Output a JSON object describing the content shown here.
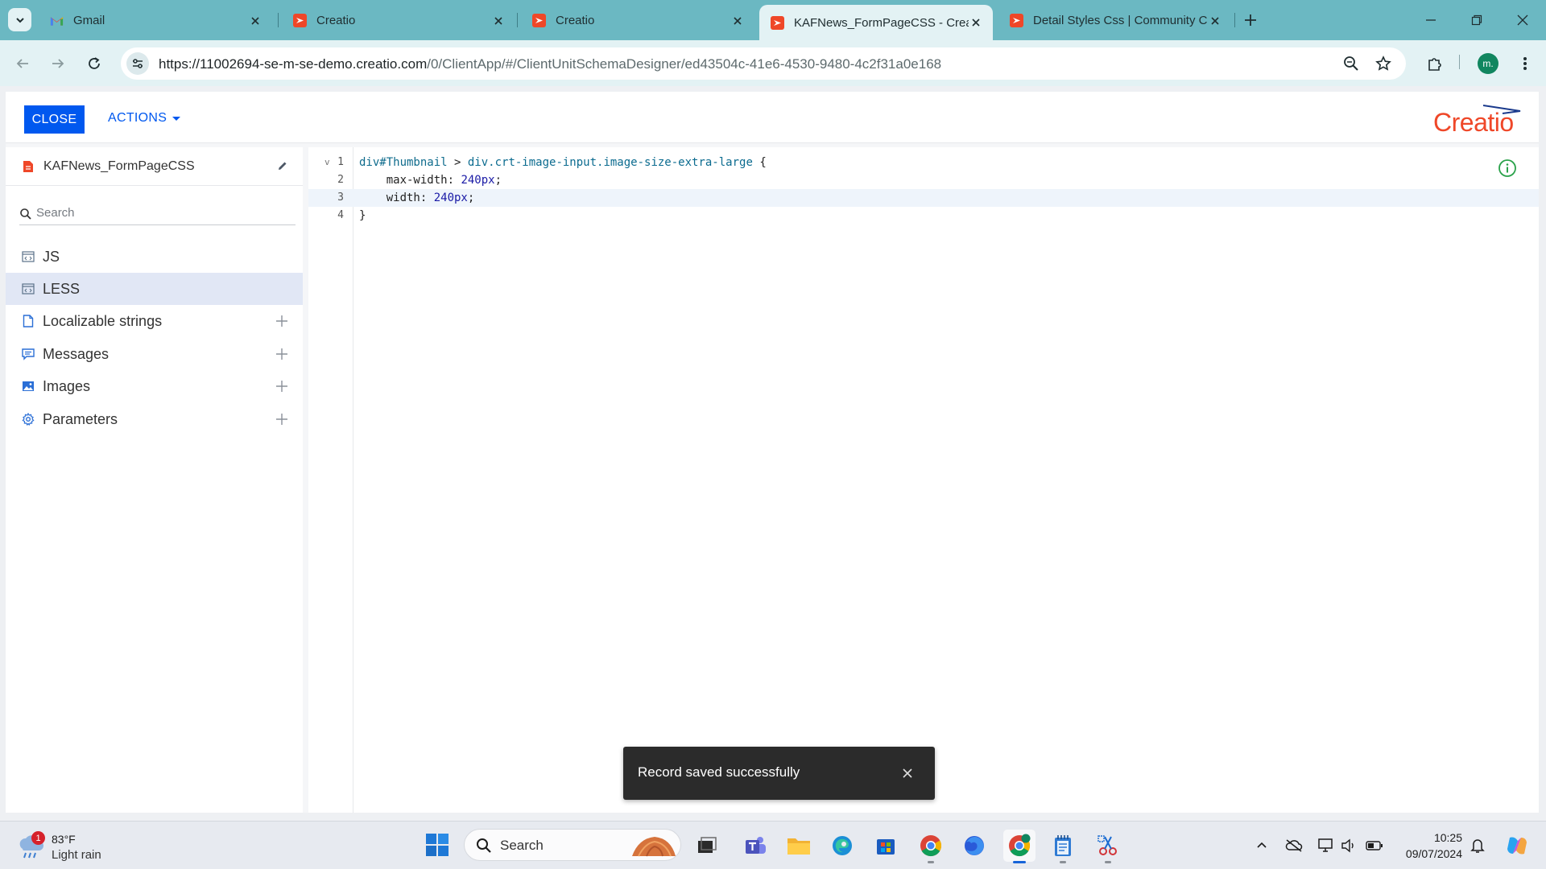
{
  "browser": {
    "tabs": [
      {
        "title": "Gmail"
      },
      {
        "title": "Creatio"
      },
      {
        "title": "Creatio"
      },
      {
        "title": "KAFNews_FormPageCSS - Creat"
      },
      {
        "title": "Detail Styles Css | Community C"
      }
    ],
    "url_host": "https://11002694-se-m-se-demo.creatio.com",
    "url_path": "/0/ClientApp/#/ClientUnitSchemaDesigner/ed43504c-41e6-4530-9480-4c2f31a0e168",
    "profile_initial": "m."
  },
  "app": {
    "close_label": "CLOSE",
    "actions_label": "ACTIONS",
    "logo_text": "Creatio",
    "schema_name": "KAFNews_FormPageCSS",
    "search_placeholder": "Search",
    "sidebar_items": [
      {
        "label": "JS",
        "icon": "code-icon",
        "addable": false
      },
      {
        "label": "LESS",
        "icon": "code-icon",
        "addable": false
      },
      {
        "label": "Localizable strings",
        "icon": "document-icon",
        "addable": true
      },
      {
        "label": "Messages",
        "icon": "message-icon",
        "addable": true
      },
      {
        "label": "Images",
        "icon": "image-icon",
        "addable": true
      },
      {
        "label": "Parameters",
        "icon": "settings-icon",
        "addable": true
      }
    ],
    "selected_item": "LESS",
    "code_lines": [
      {
        "num": "1",
        "fold": "v",
        "sel": "div#Thumbnail",
        "rest1": " > ",
        "sel2": "div.crt-image-input.image-size-extra-large",
        "rest2": " {"
      },
      {
        "num": "2",
        "prop": "    max-width: ",
        "val": "240px",
        "end": ";"
      },
      {
        "num": "3",
        "prop": "    width: ",
        "val": "240px",
        "end": ";"
      },
      {
        "num": "4",
        "text": "}"
      }
    ],
    "toast_message": "Record saved successfully"
  },
  "taskbar": {
    "weather_badge": "1",
    "temperature": "83°F",
    "condition": "Light rain",
    "search_label": "Search",
    "time": "10:25",
    "date": "09/07/2024"
  },
  "colors": {
    "accent_blue": "#0058ef",
    "brand_red": "#ef4728",
    "tab_strip": "#6bb8c2"
  }
}
